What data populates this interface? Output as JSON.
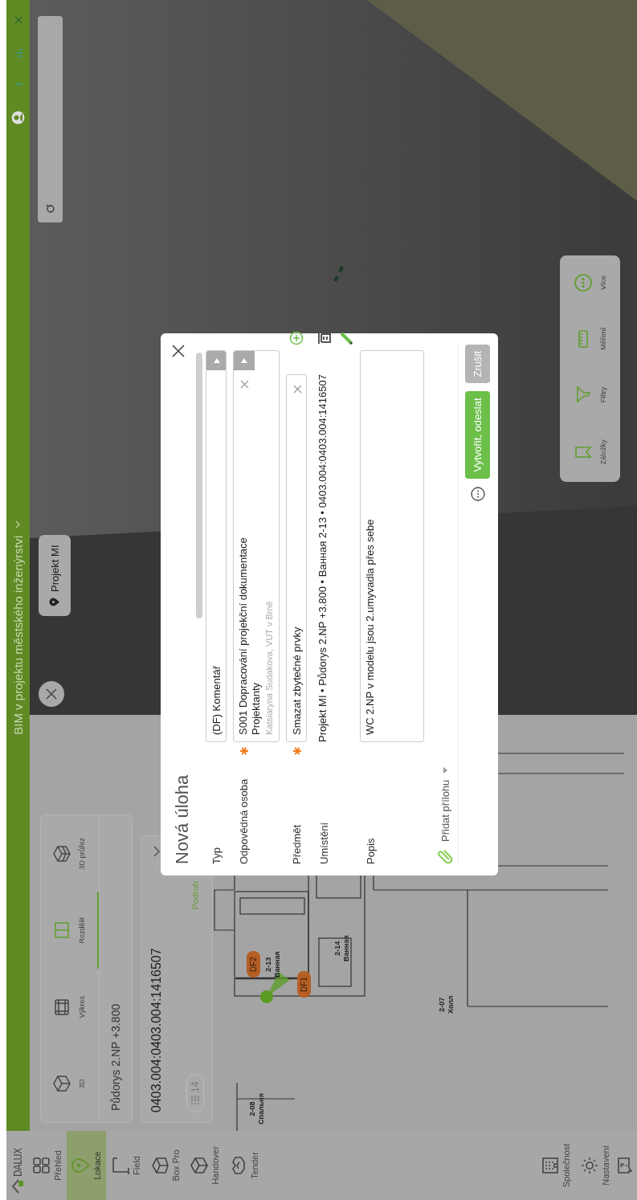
{
  "app": {
    "logo": "DALUX"
  },
  "sidebar": {
    "items": [
      {
        "label": "Přehled",
        "selected": false
      },
      {
        "label": "Lokace",
        "selected": true
      },
      {
        "label": "Field",
        "selected": false
      },
      {
        "label": "Box Pro",
        "selected": false
      },
      {
        "label": "Handover",
        "selected": false
      },
      {
        "label": "Tender",
        "selected": false
      }
    ],
    "bottom_items": [
      {
        "label": "Společnost"
      },
      {
        "label": "Nastavení"
      }
    ]
  },
  "header": {
    "title": "BIM v projektu městského inženýrství"
  },
  "plan_panel": {
    "view_modes": [
      {
        "label": "3D",
        "selected": false
      },
      {
        "label": "Výkres",
        "selected": false
      },
      {
        "label": "Rozdělit",
        "selected": true
      },
      {
        "label": "3D průřez",
        "selected": false
      }
    ],
    "floor": "Půdorys 2.NP +3.800"
  },
  "location_card": {
    "code": "0403.004:0403.004:1416507",
    "count": "14",
    "link": "Podrob"
  },
  "plan": {
    "rooms": [
      {
        "number": "2-08",
        "name": "Спальня"
      },
      {
        "number": "2-13",
        "name": "Ванная"
      },
      {
        "number": "2-14",
        "name": "Ванная"
      },
      {
        "number": "2-07",
        "name": "Холл"
      }
    ],
    "markers": [
      {
        "label": "DF2"
      },
      {
        "label": "DF1"
      }
    ]
  },
  "viewer": {
    "pin": "Projekt MI",
    "toolbar": [
      {
        "label": "Záložky"
      },
      {
        "label": "Filtry"
      },
      {
        "label": "Měření"
      },
      {
        "label": "Více"
      }
    ]
  },
  "dialog": {
    "title": "Nová úloha",
    "fields": [
      {
        "kind": "select",
        "label": "Typ",
        "required": false,
        "value": "(DF) Komentář"
      },
      {
        "kind": "person",
        "label": "Odpovědná osoba",
        "required": true,
        "value": "S001 Dopracování projekční dokumentace",
        "value_2": "Projektanty",
        "detail": "Katsiaryna Sudakova, VUT v Brně"
      },
      {
        "kind": "text",
        "label": "Předmět",
        "required": true,
        "value": "Smazat zbytečné prvky"
      },
      {
        "kind": "location",
        "label": "Umístění",
        "required": false,
        "value": "Projekt MI • Půdorys 2.NP +3.800 • Ванная 2-13 • 0403.004:0403.004:1416507"
      },
      {
        "kind": "textarea",
        "label": "Popis",
        "required": false,
        "value": "WC 2.NP v modelu jsou 2.umyvadla přes sebe"
      }
    ],
    "attachment": "Přidat přílohu",
    "submit": "Vytvořit, odeslat",
    "cancel": "Zrušit"
  }
}
